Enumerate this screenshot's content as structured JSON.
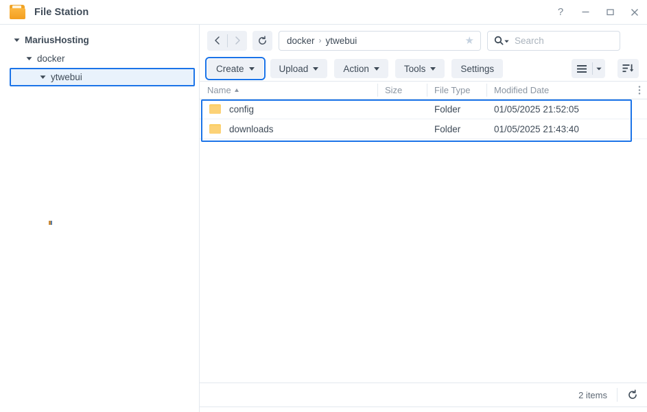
{
  "window": {
    "title": "File Station",
    "app_icon": "folder-icon",
    "controls": {
      "help": "?",
      "minimize": "minimize-icon",
      "maximize": "maximize-icon",
      "close": "close-icon"
    }
  },
  "sidebar": {
    "items": [
      {
        "label": "MariusHosting",
        "level": 0,
        "expanded": true,
        "selected": false
      },
      {
        "label": "docker",
        "level": 1,
        "expanded": true,
        "selected": false
      },
      {
        "label": "ytwebui",
        "level": 2,
        "expanded": true,
        "selected": true
      }
    ]
  },
  "navbar": {
    "back": "chevron-left-icon",
    "forward": "chevron-right-icon",
    "refresh": "refresh-icon",
    "breadcrumb": {
      "separator": "›",
      "parts": [
        "docker",
        "ytwebui"
      ],
      "favorite": "star-icon"
    },
    "search": {
      "icon": "search-icon",
      "placeholder": "Search",
      "value": ""
    }
  },
  "toolbar": {
    "buttons": [
      {
        "label": "Create",
        "dropdown": true,
        "highlighted": true
      },
      {
        "label": "Upload",
        "dropdown": true,
        "highlighted": false
      },
      {
        "label": "Action",
        "dropdown": true,
        "highlighted": false
      },
      {
        "label": "Tools",
        "dropdown": true,
        "highlighted": false
      },
      {
        "label": "Settings",
        "dropdown": false,
        "highlighted": false
      }
    ],
    "view_mode_icon": "list-view-icon",
    "view_mode_dropdown_icon": "chevron-down-icon",
    "sort_icon": "sort-descending-icon"
  },
  "filelist": {
    "columns": [
      {
        "key": "name",
        "label": "Name",
        "sorted": "asc"
      },
      {
        "key": "size",
        "label": "Size"
      },
      {
        "key": "type",
        "label": "File Type"
      },
      {
        "key": "date",
        "label": "Modified Date"
      }
    ],
    "column_menu_icon": "more-vertical-icon",
    "rows": [
      {
        "icon": "folder-icon",
        "name": "config",
        "size": "",
        "type": "Folder",
        "date": "01/05/2025 21:52:05"
      },
      {
        "icon": "folder-icon",
        "name": "downloads",
        "size": "",
        "type": "Folder",
        "date": "01/05/2025 21:43:40"
      }
    ],
    "rows_highlighted": true
  },
  "statusbar": {
    "count": "2 items",
    "refresh_icon": "refresh-icon"
  },
  "colors": {
    "accent_highlight": "#1a73e8",
    "selection_bg": "#e9f2fc",
    "text": "#3e4a57",
    "muted_text": "#8b95a1",
    "button_bg": "#eef1f6",
    "border": "#e2e8ee",
    "folder": "#fbd06b"
  }
}
